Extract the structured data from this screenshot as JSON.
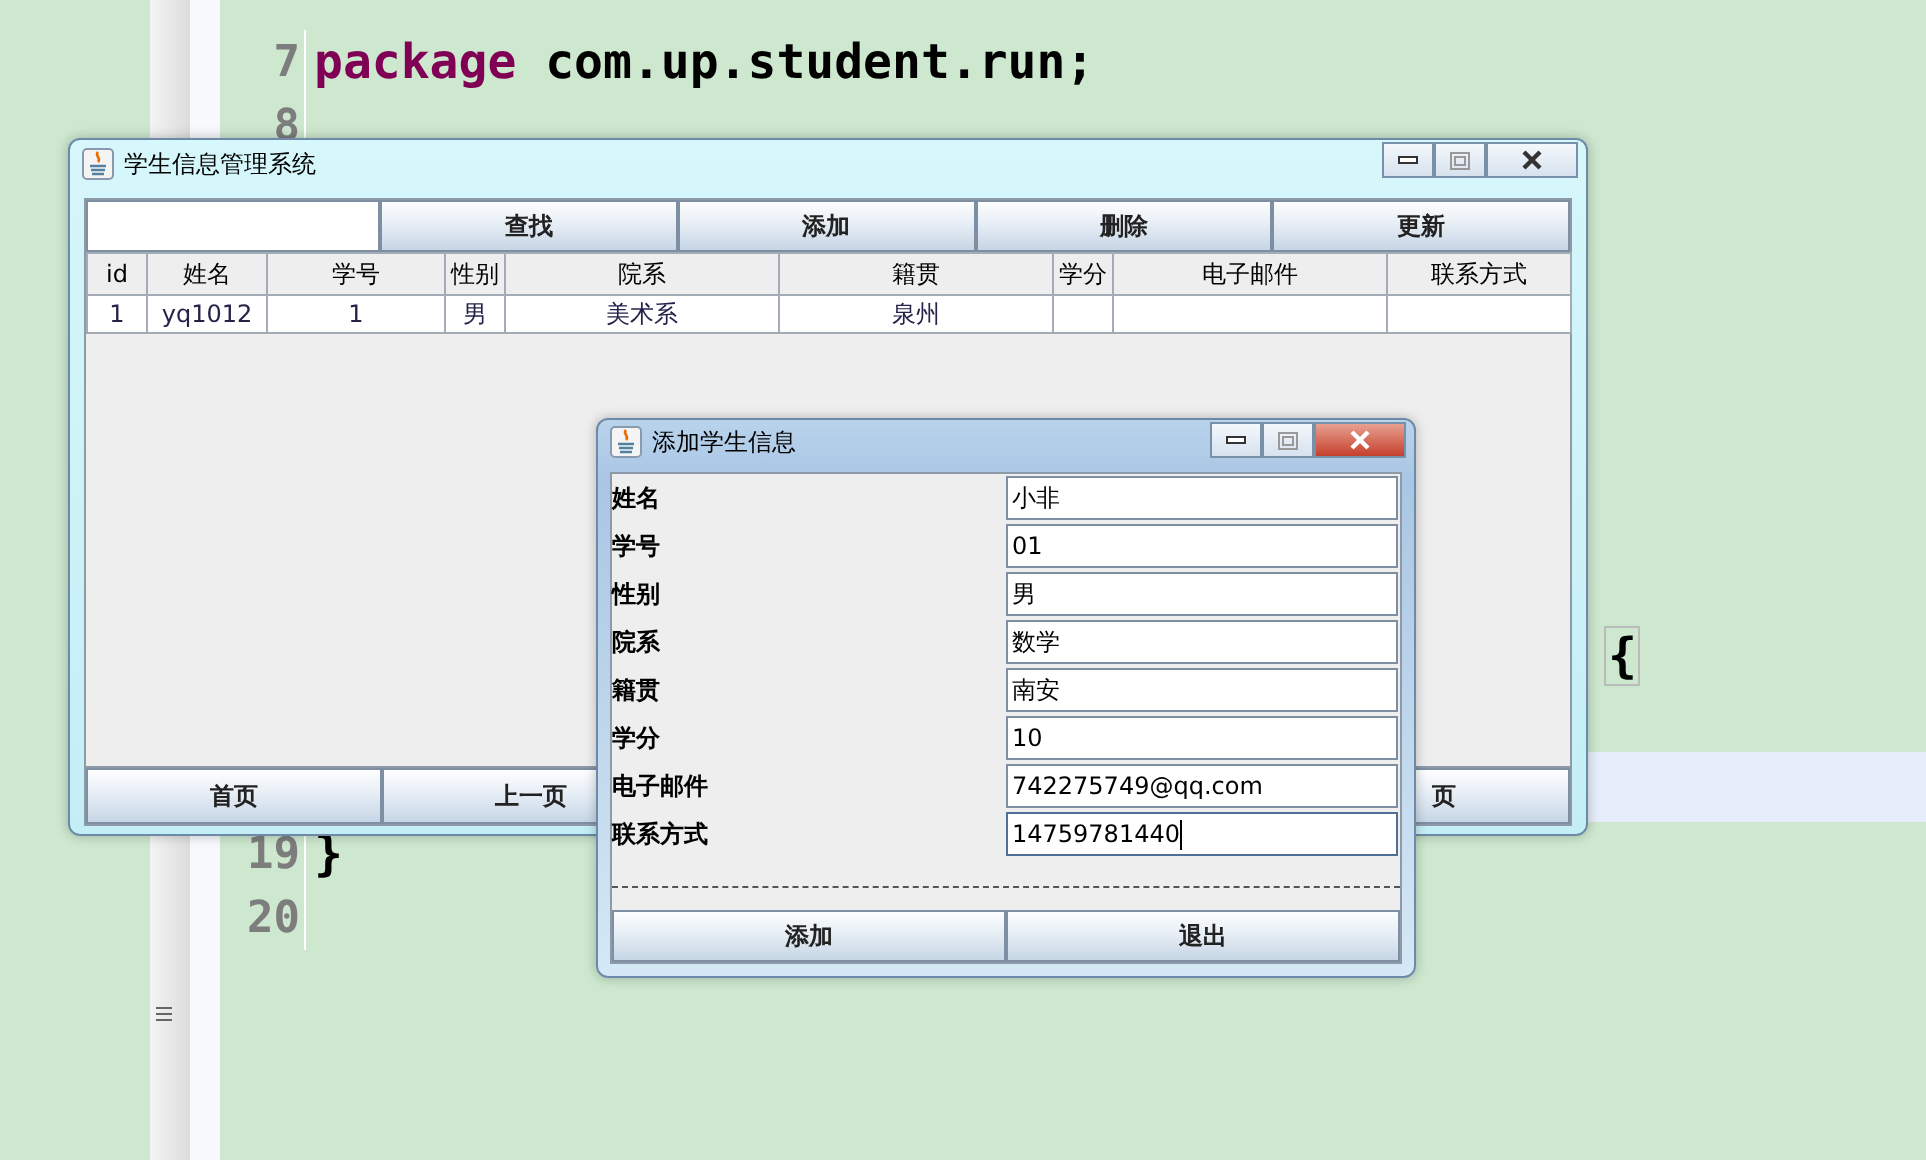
{
  "editor": {
    "lines": [
      {
        "kind": "code",
        "number": "7",
        "keyword": "package",
        "code": "com.up.student.run;",
        "current": false
      },
      {
        "kind": "code",
        "number": "8",
        "current": false
      },
      {
        "kind": "covered",
        "code": "{",
        "current": false
      },
      {
        "kind": "covered",
        "current": true
      },
      {
        "kind": "code",
        "number": "19",
        "code": "}",
        "current": false
      },
      {
        "kind": "code",
        "number": "20",
        "current": false
      }
    ]
  },
  "main_window": {
    "title": "学生信息管理系统",
    "toolbar_buttons": [
      "查找",
      "添加",
      "删除",
      "更新"
    ],
    "table": {
      "columns": [
        "id",
        "姓名",
        "学号",
        "性别",
        "院系",
        "籍贯",
        "学分",
        "电子邮件",
        "联系方式"
      ],
      "rows": [
        [
          "1",
          "yq1012",
          "1",
          "男",
          "美术系",
          "泉州",
          "",
          "",
          ""
        ]
      ]
    },
    "nav_buttons": [
      "首页",
      "上一页",
      "页"
    ]
  },
  "dialog": {
    "title": "添加学生信息",
    "fields": [
      {
        "label": "姓名",
        "value": "小非",
        "focused": false
      },
      {
        "label": "学号",
        "value": "01",
        "focused": false
      },
      {
        "label": "性别",
        "value": "男",
        "focused": false
      },
      {
        "label": "院系",
        "value": "数学",
        "focused": false
      },
      {
        "label": "籍贯",
        "value": "南安",
        "focused": false
      },
      {
        "label": "学分",
        "value": "10",
        "focused": false
      },
      {
        "label": "电子邮件",
        "value": "742275749@qq.com",
        "focused": false
      },
      {
        "label": "联系方式",
        "value": "14759781440",
        "focused": true
      }
    ],
    "buttons": [
      "添加",
      "退出"
    ]
  }
}
